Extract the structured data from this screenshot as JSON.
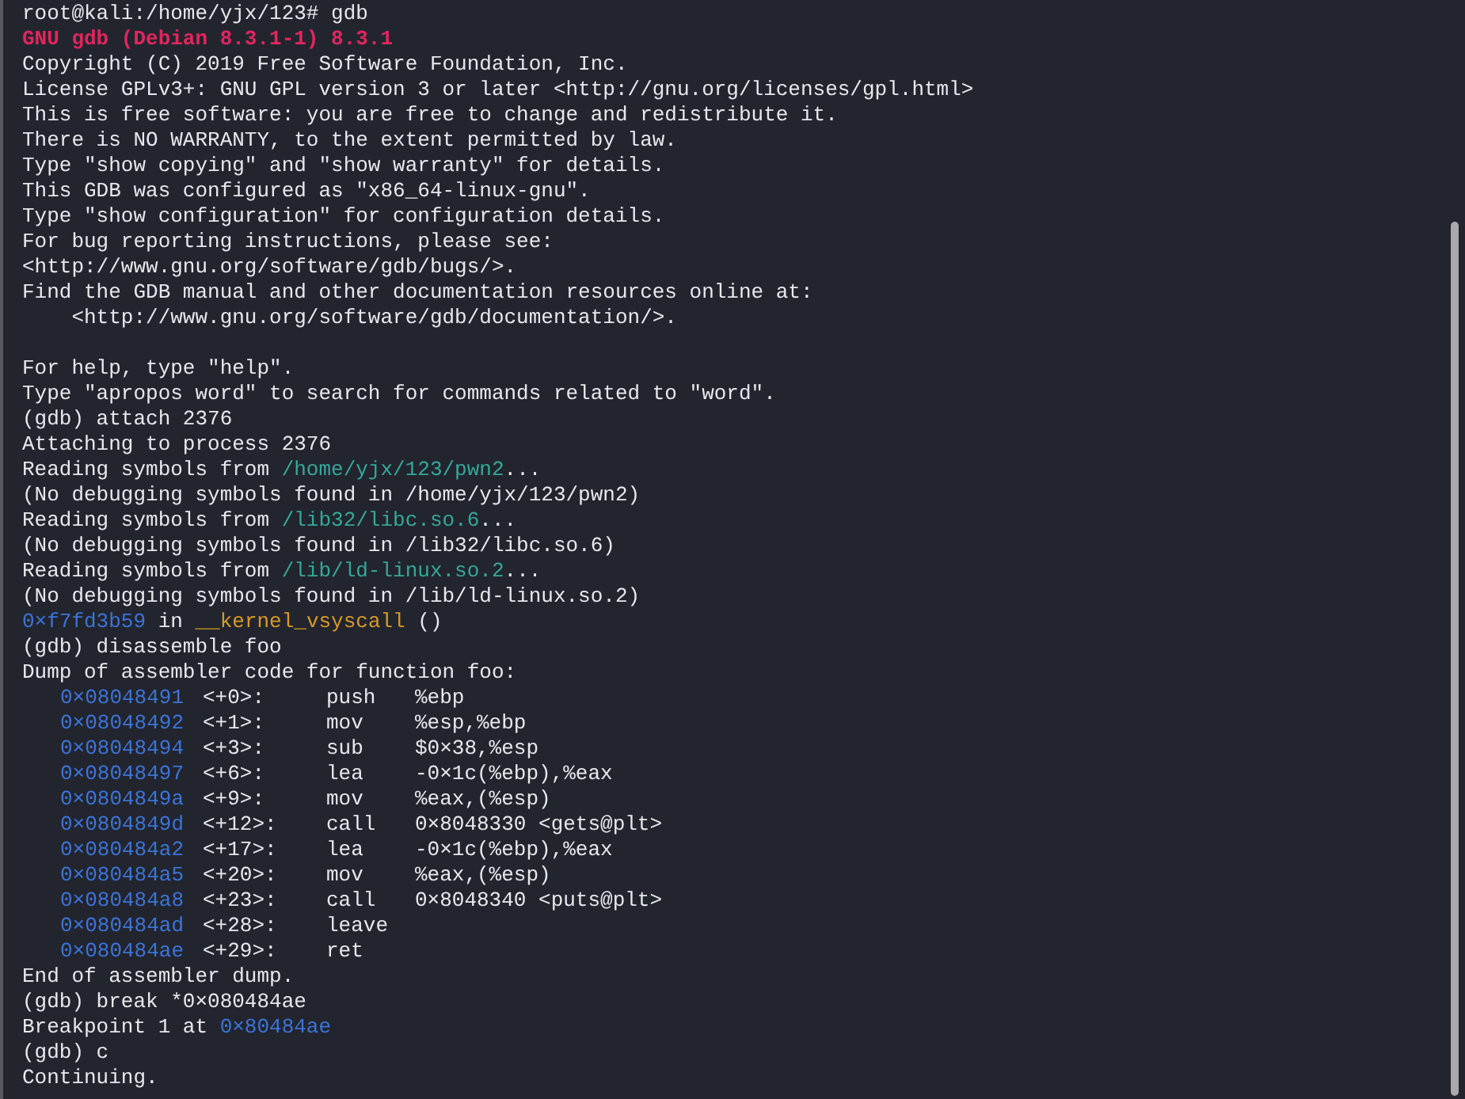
{
  "terminal": {
    "lines": [
      {
        "kind": "text",
        "segments": [
          {
            "text": "root@kali:/home/yjx/123# gdb",
            "kind": "plain"
          }
        ]
      },
      {
        "kind": "text",
        "segments": [
          {
            "text": "GNU gdb (Debian 8.3.1-1) 8.3.1",
            "kind": "banner"
          }
        ]
      },
      {
        "kind": "text",
        "segments": [
          {
            "text": "Copyright (C) 2019 Free Software Foundation, Inc.",
            "kind": "plain"
          }
        ]
      },
      {
        "kind": "text",
        "segments": [
          {
            "text": "License GPLv3+: GNU GPL version 3 or later <http://gnu.org/licenses/gpl.html>",
            "kind": "plain"
          }
        ]
      },
      {
        "kind": "text",
        "segments": [
          {
            "text": "This is free software: you are free to change and redistribute it.",
            "kind": "plain"
          }
        ]
      },
      {
        "kind": "text",
        "segments": [
          {
            "text": "There is NO WARRANTY, to the extent permitted by law.",
            "kind": "plain"
          }
        ]
      },
      {
        "kind": "text",
        "segments": [
          {
            "text": "Type \"show copying\" and \"show warranty\" for details.",
            "kind": "plain"
          }
        ]
      },
      {
        "kind": "text",
        "segments": [
          {
            "text": "This GDB was configured as \"x86_64-linux-gnu\".",
            "kind": "plain"
          }
        ]
      },
      {
        "kind": "text",
        "segments": [
          {
            "text": "Type \"show configuration\" for configuration details.",
            "kind": "plain"
          }
        ]
      },
      {
        "kind": "text",
        "segments": [
          {
            "text": "For bug reporting instructions, please see:",
            "kind": "plain"
          }
        ]
      },
      {
        "kind": "text",
        "segments": [
          {
            "text": "<http://www.gnu.org/software/gdb/bugs/>.",
            "kind": "plain"
          }
        ]
      },
      {
        "kind": "text",
        "segments": [
          {
            "text": "Find the GDB manual and other documentation resources online at:",
            "kind": "plain"
          }
        ]
      },
      {
        "kind": "text",
        "segments": [
          {
            "text": "    <http://www.gnu.org/software/gdb/documentation/>.",
            "kind": "plain"
          }
        ]
      },
      {
        "kind": "blank"
      },
      {
        "kind": "text",
        "segments": [
          {
            "text": "For help, type \"help\".",
            "kind": "plain"
          }
        ]
      },
      {
        "kind": "text",
        "segments": [
          {
            "text": "Type \"apropos word\" to search for commands related to \"word\".",
            "kind": "plain"
          }
        ]
      },
      {
        "kind": "text",
        "segments": [
          {
            "text": "(gdb) attach 2376",
            "kind": "plain"
          }
        ]
      },
      {
        "kind": "text",
        "segments": [
          {
            "text": "Attaching to process 2376",
            "kind": "plain"
          }
        ]
      },
      {
        "kind": "text",
        "segments": [
          {
            "text": "Reading symbols from ",
            "kind": "plain"
          },
          {
            "text": "/home/yjx/123/pwn2",
            "kind": "path"
          },
          {
            "text": "...",
            "kind": "plain"
          }
        ]
      },
      {
        "kind": "text",
        "segments": [
          {
            "text": "(No debugging symbols found in /home/yjx/123/pwn2)",
            "kind": "plain"
          }
        ]
      },
      {
        "kind": "text",
        "segments": [
          {
            "text": "Reading symbols from ",
            "kind": "plain"
          },
          {
            "text": "/lib32/libc.so.6",
            "kind": "path"
          },
          {
            "text": "...",
            "kind": "plain"
          }
        ]
      },
      {
        "kind": "text",
        "segments": [
          {
            "text": "(No debugging symbols found in /lib32/libc.so.6)",
            "kind": "plain"
          }
        ]
      },
      {
        "kind": "text",
        "segments": [
          {
            "text": "Reading symbols from ",
            "kind": "plain"
          },
          {
            "text": "/lib/ld-linux.so.2",
            "kind": "path"
          },
          {
            "text": "...",
            "kind": "plain"
          }
        ]
      },
      {
        "kind": "text",
        "segments": [
          {
            "text": "(No debugging symbols found in /lib/ld-linux.so.2)",
            "kind": "plain"
          }
        ]
      },
      {
        "kind": "text",
        "segments": [
          {
            "text": "0×f7fd3b59",
            "kind": "address"
          },
          {
            "text": " in ",
            "kind": "plain"
          },
          {
            "text": "__kernel_vsyscall",
            "kind": "function"
          },
          {
            "text": " ()",
            "kind": "plain"
          }
        ]
      },
      {
        "kind": "text",
        "segments": [
          {
            "text": "(gdb) disassemble foo",
            "kind": "plain"
          }
        ]
      },
      {
        "kind": "text",
        "segments": [
          {
            "text": "Dump of assembler code for function foo:",
            "kind": "plain"
          }
        ]
      },
      {
        "kind": "instruction",
        "address": "0×08048491",
        "offset": "<+0>:",
        "mnemonic": "push",
        "operands": "%ebp"
      },
      {
        "kind": "instruction",
        "address": "0×08048492",
        "offset": "<+1>:",
        "mnemonic": "mov",
        "operands": "%esp,%ebp"
      },
      {
        "kind": "instruction",
        "address": "0×08048494",
        "offset": "<+3>:",
        "mnemonic": "sub",
        "operands": "$0×38,%esp"
      },
      {
        "kind": "instruction",
        "address": "0×08048497",
        "offset": "<+6>:",
        "mnemonic": "lea",
        "operands": "-0×1c(%ebp),%eax"
      },
      {
        "kind": "instruction",
        "address": "0×0804849a",
        "offset": "<+9>:",
        "mnemonic": "mov",
        "operands": "%eax,(%esp)"
      },
      {
        "kind": "instruction",
        "address": "0×0804849d",
        "offset": "<+12>:",
        "mnemonic": "call",
        "operands": "0×8048330 <gets@plt>"
      },
      {
        "kind": "instruction",
        "address": "0×080484a2",
        "offset": "<+17>:",
        "mnemonic": "lea",
        "operands": "-0×1c(%ebp),%eax"
      },
      {
        "kind": "instruction",
        "address": "0×080484a5",
        "offset": "<+20>:",
        "mnemonic": "mov",
        "operands": "%eax,(%esp)"
      },
      {
        "kind": "instruction",
        "address": "0×080484a8",
        "offset": "<+23>:",
        "mnemonic": "call",
        "operands": "0×8048340 <puts@plt>"
      },
      {
        "kind": "instruction",
        "address": "0×080484ad",
        "offset": "<+28>:",
        "mnemonic": "leave"
      },
      {
        "kind": "instruction",
        "address": "0×080484ae",
        "offset": "<+29>:",
        "mnemonic": "ret"
      },
      {
        "kind": "text",
        "segments": [
          {
            "text": "End of assembler dump.",
            "kind": "plain"
          }
        ]
      },
      {
        "kind": "text",
        "segments": [
          {
            "text": "(gdb) break *0×080484ae",
            "kind": "plain"
          }
        ]
      },
      {
        "kind": "text",
        "segments": [
          {
            "text": "Breakpoint 1 at ",
            "kind": "plain"
          },
          {
            "text": "0×80484ae",
            "kind": "address"
          }
        ]
      },
      {
        "kind": "text",
        "segments": [
          {
            "text": "(gdb) c",
            "kind": "plain"
          }
        ]
      },
      {
        "kind": "text",
        "segments": [
          {
            "text": "Continuing.",
            "kind": "plain"
          }
        ]
      }
    ]
  }
}
